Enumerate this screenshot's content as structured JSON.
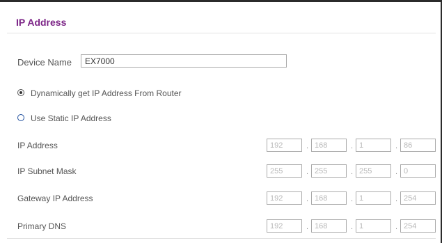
{
  "section_title": "IP Address",
  "device": {
    "label": "Device Name",
    "value": "EX7000"
  },
  "radios": {
    "dynamic": {
      "label": "Dynamically get IP Address From Router",
      "checked": true
    },
    "static": {
      "label": "Use Static IP Address",
      "checked": false
    }
  },
  "rows": [
    {
      "label": "IP Address",
      "octets": [
        "192",
        "168",
        "1",
        "86"
      ]
    },
    {
      "label": "IP Subnet Mask",
      "octets": [
        "255",
        "255",
        "255",
        "0"
      ]
    },
    {
      "label": "Gateway IP Address",
      "octets": [
        "192",
        "168",
        "1",
        "254"
      ]
    },
    {
      "label": "Primary DNS",
      "octets": [
        "192",
        "168",
        "1",
        "254"
      ]
    }
  ],
  "separator": ".",
  "colors": {
    "title": "#7b2386",
    "radio_static": "#1f4e9d"
  }
}
